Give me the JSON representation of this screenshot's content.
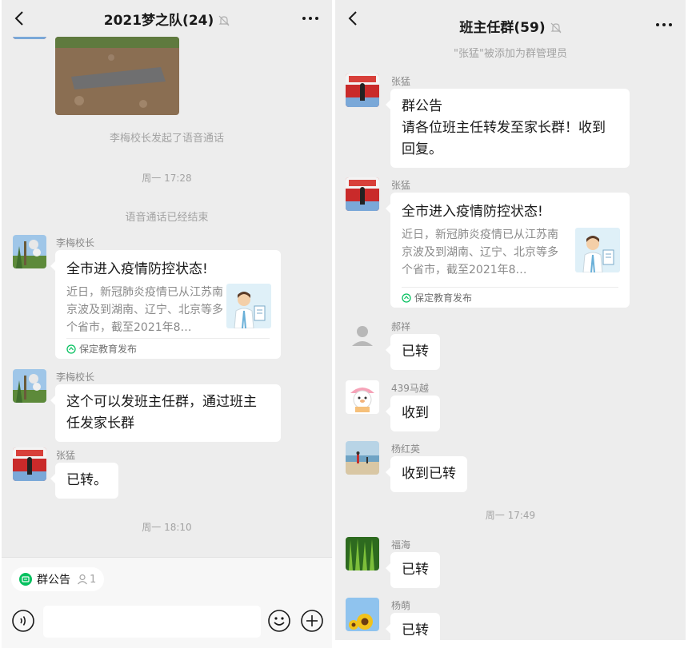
{
  "left": {
    "header": {
      "title": "2021梦之队(24)"
    },
    "system": {
      "voice_started": "李梅校长发起了语音通话",
      "voice_ended": "语音通话已经结束"
    },
    "times": {
      "t1": "周一 17:28",
      "t2": "周一 18:10"
    },
    "messages": [
      {
        "sender": "李梅校长",
        "card": {
          "title": "全市进入疫情防控状态!",
          "desc": "近日，新冠肺炎疫情已从江苏南京波及到湖南、辽宁、北京等多个省市，截至2021年8…",
          "source": "保定教育发布"
        }
      },
      {
        "sender": "李梅校长",
        "text": "这个可以发班主任群，通过班主任发家长群"
      },
      {
        "sender": "张猛",
        "text": "已转。"
      }
    ],
    "footer": {
      "notice_label": "群公告",
      "notice_count": "1"
    }
  },
  "right": {
    "header": {
      "title": "班主任群(59)"
    },
    "system": {
      "admin_added": "\"张猛\"被添加为群管理员"
    },
    "times": {
      "t1": "周一 17:49"
    },
    "messages": [
      {
        "sender": "张猛",
        "text": "群公告\n请各位班主任转发至家长群！收到回复。"
      },
      {
        "sender": "张猛",
        "card": {
          "title": "全市进入疫情防控状态!",
          "desc": "近日，新冠肺炎疫情已从江苏南京波及到湖南、辽宁、北京等多个省市，截至2021年8…",
          "source": "保定教育发布"
        }
      },
      {
        "sender": "郝祥",
        "text": "已转"
      },
      {
        "sender": "439马越",
        "text": "收到"
      },
      {
        "sender": "杨红英",
        "text": "收到已转"
      },
      {
        "sender": "福海",
        "text": "已转"
      },
      {
        "sender": "杨萌",
        "text": "已转"
      }
    ]
  },
  "icons": {
    "back": "chevron-left-icon",
    "mute": "bell-off-icon",
    "more": "more-dots-icon",
    "voice": "voice-icon",
    "emoji": "emoji-icon",
    "plus": "plus-icon"
  },
  "colors": {
    "chat_bg": "#ededed",
    "bubble": "#ffffff",
    "system_text": "#a3a3a3",
    "accent_green": "#07c160"
  }
}
